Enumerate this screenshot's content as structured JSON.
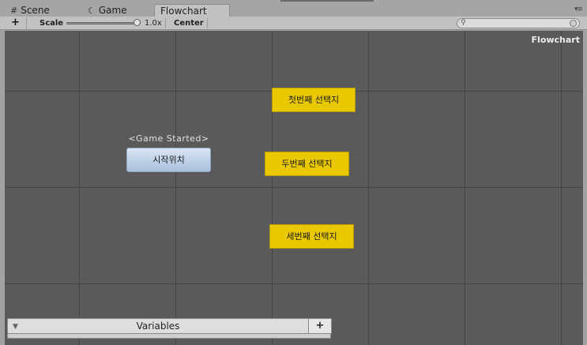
{
  "tabs": {
    "scene": {
      "icon": "#",
      "label": "Scene"
    },
    "game": {
      "icon": "☾",
      "label": "Game"
    },
    "flowchart": {
      "label": "Flowchart"
    }
  },
  "toolbar": {
    "add_label": "+",
    "scale_label": "Scale",
    "scale_value": "1.0x",
    "scale_fraction": 1.0,
    "center_label": "Center",
    "search_value": ""
  },
  "canvas": {
    "title": "Flowchart",
    "start_label": "<Game Started>",
    "start_node": "시작위치",
    "choices": [
      "첫번째 선택지",
      "두번째 선택지",
      "세번째 선택지"
    ],
    "colors": {
      "background": "#5a5a5a",
      "choice_node": "#e9c800",
      "start_node": "#c4d5ea"
    }
  },
  "variables": {
    "title": "Variables",
    "add_label": "+"
  }
}
